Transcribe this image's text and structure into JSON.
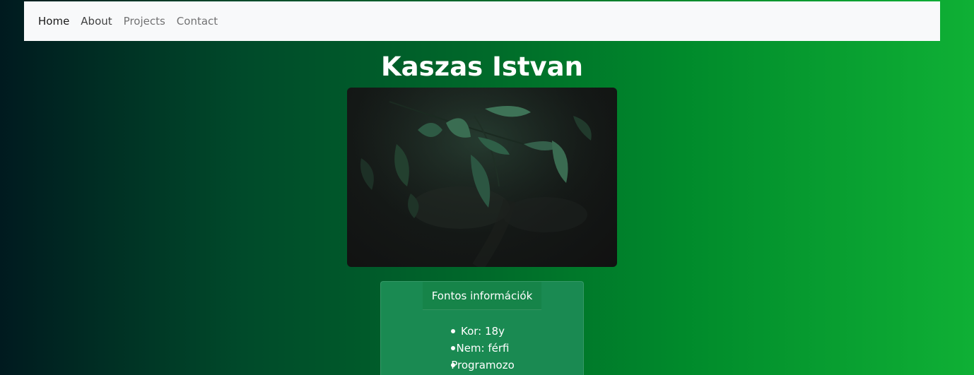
{
  "nav": {
    "items": [
      {
        "label": "Home"
      },
      {
        "label": "About"
      },
      {
        "label": "Projects"
      },
      {
        "label": "Contact"
      }
    ]
  },
  "hero": {
    "title": "Kaszas Istvan"
  },
  "info_card": {
    "header": "Fontos információk",
    "items": [
      {
        "text": "Kor: 18y"
      },
      {
        "text": "Nem: férfi"
      },
      {
        "text": "Programozo"
      }
    ]
  },
  "colors": {
    "navbar_bg": "#f8f9fa",
    "card_bg": "#1a8a52",
    "gradient_start": "#001a1f",
    "gradient_end": "#0fb035"
  },
  "icons": {
    "photo": "leaves-photo"
  }
}
